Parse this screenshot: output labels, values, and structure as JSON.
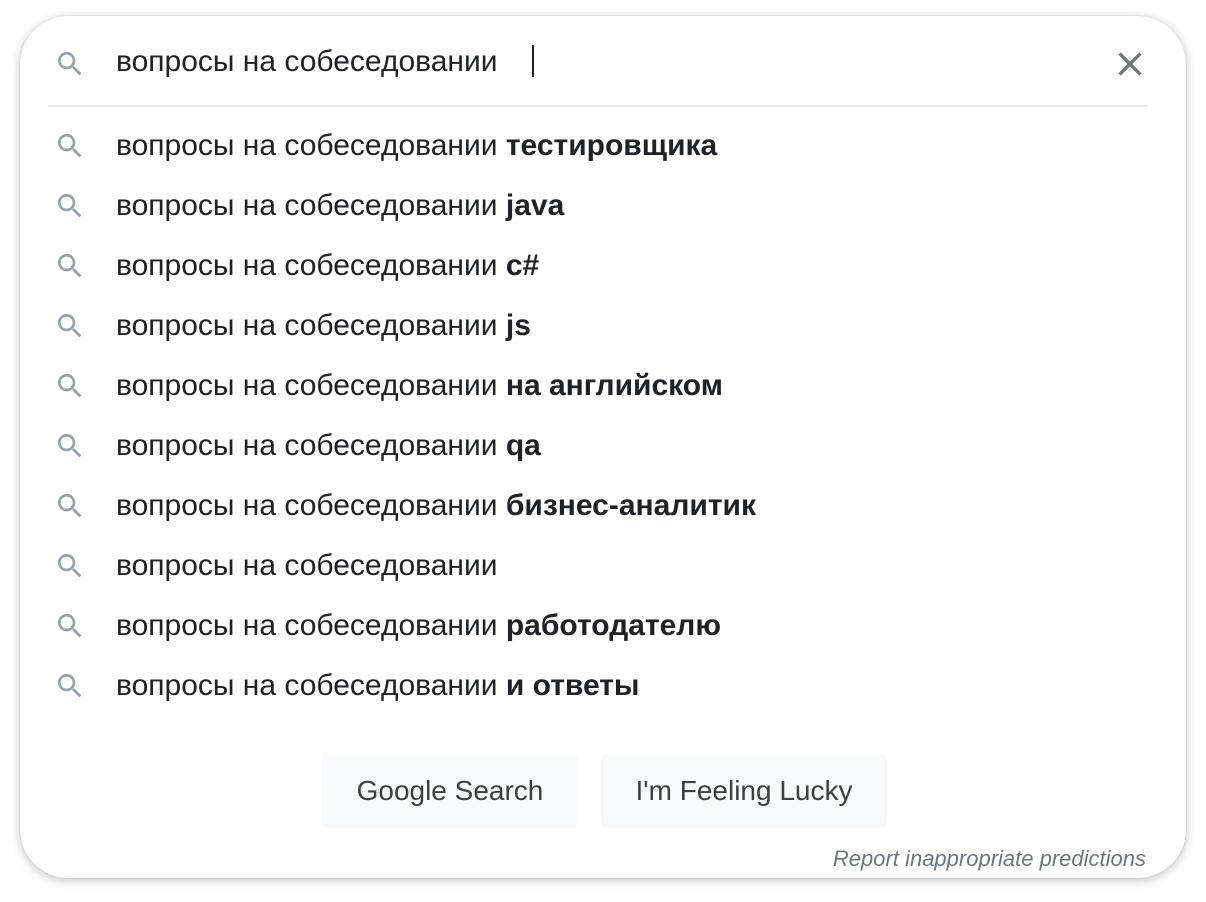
{
  "search": {
    "query": "вопросы на собеседовании ",
    "icon": "search-icon",
    "clear_icon": "close-icon"
  },
  "suggestions": [
    {
      "prefix": "вопросы на собеседовании ",
      "completion": "тестировщика"
    },
    {
      "prefix": "вопросы на собеседовании ",
      "completion": "java"
    },
    {
      "prefix": "вопросы на собеседовании ",
      "completion": "c#"
    },
    {
      "prefix": "вопросы на собеседовании ",
      "completion": "js"
    },
    {
      "prefix": "вопросы на собеседовании ",
      "completion": "на английском"
    },
    {
      "prefix": "вопросы на собеседовании ",
      "completion": "qa"
    },
    {
      "prefix": "вопросы на собеседовании ",
      "completion": "бизнес-аналитик"
    },
    {
      "prefix": "вопросы на собеседовании",
      "completion": ""
    },
    {
      "prefix": "вопросы на собеседовании ",
      "completion": "работодателю"
    },
    {
      "prefix": "вопросы на собеседовании ",
      "completion": "и ответы"
    }
  ],
  "buttons": {
    "search_label": "Google Search",
    "lucky_label": "I'm Feeling Lucky"
  },
  "report_label": "Report inappropriate predictions",
  "colors": {
    "text": "#202124",
    "icon": "#9aa0a6",
    "button_bg": "#f8f9fa",
    "report": "#70757a"
  }
}
